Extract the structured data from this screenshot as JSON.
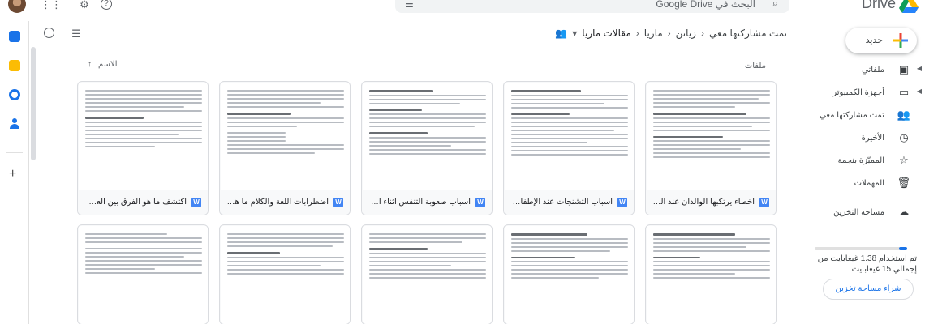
{
  "app": {
    "brand": "Drive"
  },
  "search": {
    "placeholder": "البحث في Google Drive"
  },
  "icons": {
    "apps": "apps-icon",
    "settings": "gear-icon",
    "help": "help-icon",
    "search": "search-icon",
    "tune": "tune-icon",
    "info": "info-icon",
    "list_view": "list-view-icon",
    "shared_people": "people-icon"
  },
  "breadcrumb": {
    "items": [
      "تمت مشاركتها معي",
      "زيانن",
      "ماريا",
      "مقالات ماريا"
    ]
  },
  "sidebar": {
    "new_label": "جديد",
    "items": [
      {
        "label": "ملفاتي",
        "icon": "my-drive-icon",
        "has_caret": true
      },
      {
        "label": "أجهزة الكمبيوتر",
        "icon": "computers-icon",
        "has_caret": true
      },
      {
        "label": "تمت مشاركتها معي",
        "icon": "shared-icon",
        "has_caret": false
      },
      {
        "label": "الأخيرة",
        "icon": "clock-icon",
        "has_caret": false
      },
      {
        "label": "المميّزة بنجمة",
        "icon": "star-icon",
        "has_caret": false
      },
      {
        "label": "المهملات",
        "icon": "trash-icon",
        "has_caret": false
      }
    ],
    "storage_label": "مساحة التخزين",
    "storage_used_fraction": 0.092,
    "storage_text": "تم استخدام 1.38 غيغابايت من إجمالي 15 غيغابايت",
    "buy_label": "شراء مساحة تخزين"
  },
  "main": {
    "section_label": "ملفات",
    "sort_label": "الاسم",
    "files": [
      {
        "title": "أخطاء يرتكبها الوالدان عند التعامل مع الأ..."
      },
      {
        "title": "أسباب التشنجات عند الإطفال وتصائح مه..."
      },
      {
        "title": "أسباب صعوبة التنفس اثناء الرضاعة عند ..."
      },
      {
        "title": "اضطرابات اللغة والكلام ما هو العلاج الأ..."
      },
      {
        "title": "اكتشف ما هو الفرق بين العلاج الوظيفي ..."
      }
    ]
  },
  "colors": {
    "accent": "#1a73e8",
    "doc_icon": "#4285f4"
  }
}
